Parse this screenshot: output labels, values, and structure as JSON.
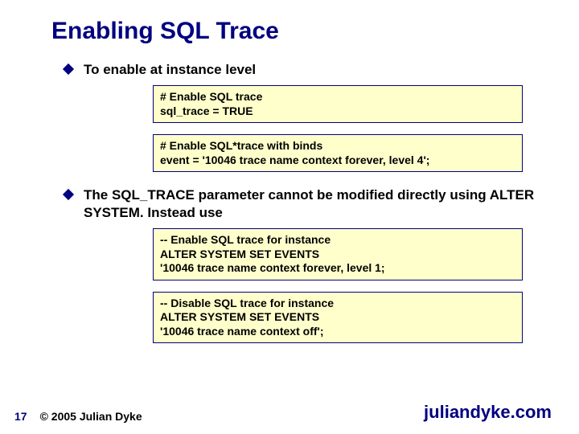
{
  "title": "Enabling SQL Trace",
  "bullets": [
    "To enable at instance level",
    "The SQL_TRACE parameter cannot be modified directly using ALTER SYSTEM. Instead use"
  ],
  "boxes": [
    "# Enable SQL trace\nsql_trace = TRUE",
    "# Enable SQL*trace with binds\nevent = '10046 trace name context forever, level 4';",
    "-- Enable SQL trace for instance\nALTER SYSTEM SET EVENTS\n'10046 trace name context forever, level 1;",
    "-- Disable SQL trace for instance\nALTER SYSTEM SET EVENTS\n'10046 trace name context off';"
  ],
  "footer": {
    "page": "17",
    "copyright": "© 2005 Julian Dyke",
    "site": "juliandyke.com"
  }
}
